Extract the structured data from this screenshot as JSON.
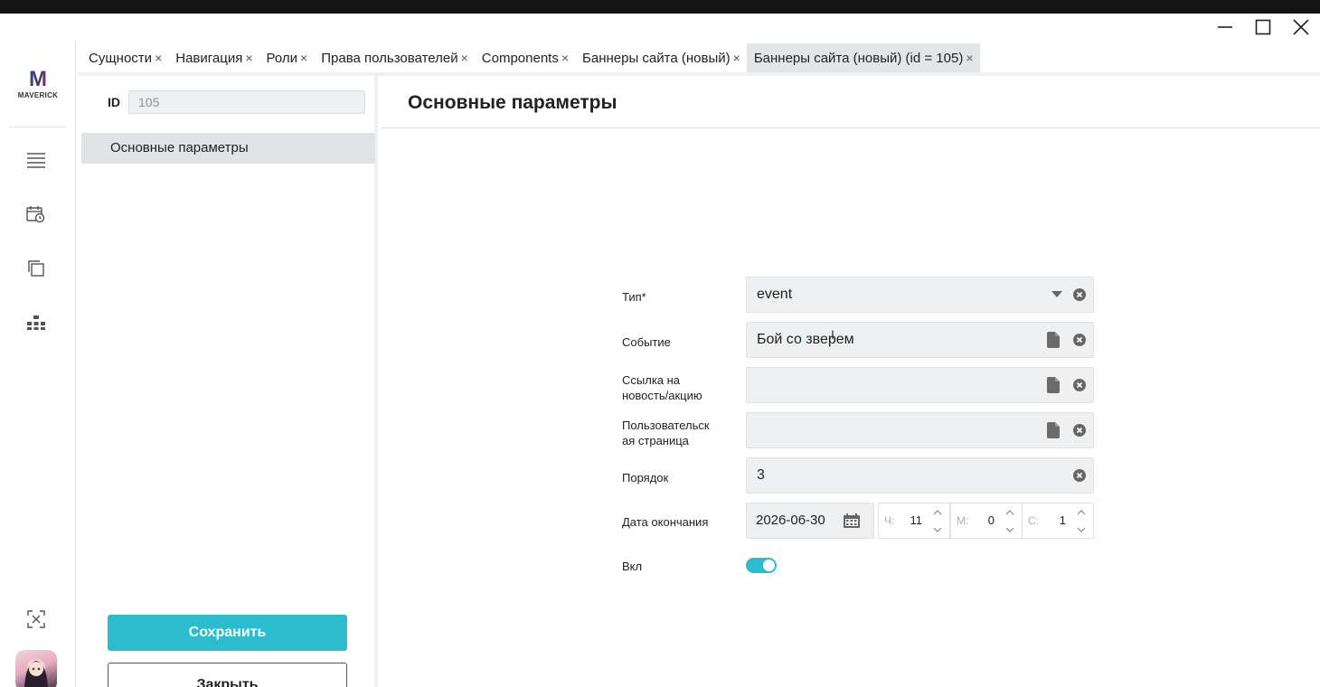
{
  "window": {
    "controls": [
      "minimize",
      "maximize",
      "close"
    ]
  },
  "logo": {
    "letter": "M",
    "text": "MAVERICK"
  },
  "rail": {
    "icons": [
      "menu-icon",
      "calendar-clock-icon",
      "copy-icon",
      "hierarchy-icon",
      "collapse-icon"
    ]
  },
  "tabs": [
    {
      "label": "Сущности",
      "close": "×"
    },
    {
      "label": "Навигация",
      "close": "×"
    },
    {
      "label": "Роли",
      "close": "×"
    },
    {
      "label": "Права пользователей",
      "close": "×"
    },
    {
      "label": "Components",
      "close": "×"
    },
    {
      "label": "Баннеры сайта (новый)",
      "close": "×"
    },
    {
      "label": "Баннеры сайта (новый) (id = 105)",
      "close": "×",
      "active": true
    }
  ],
  "left_panel": {
    "id_label": "ID",
    "id_value": "105",
    "nav_item": "Основные параметры",
    "save_button": "Сохранить",
    "close_button": "Закрыть"
  },
  "main": {
    "title": "Основные параметры",
    "fields": {
      "type": {
        "label": "Тип*",
        "value": "event"
      },
      "event": {
        "label": "Событие",
        "value": "Бой со зверем"
      },
      "news_link": {
        "label_line1": "Ссылка на",
        "label_line2": "новость/акцию",
        "value": ""
      },
      "user_page": {
        "label_line1": "Пользовательск",
        "label_line2": "ая страница",
        "value": ""
      },
      "order": {
        "label": "Порядок",
        "value": "3"
      },
      "end_date": {
        "label": "Дата окончания",
        "date": "2026-06-30",
        "hours_label": "Ч:",
        "hours": "11",
        "minutes_label": "М:",
        "minutes": "0",
        "seconds_label": "С:",
        "seconds": "1"
      },
      "enabled": {
        "label": "Вкл",
        "value": true
      }
    }
  },
  "colors": {
    "accent": "#2cbcd0",
    "field_bg": "#eef0f1",
    "active_tab_bg": "#e3e6e8"
  }
}
